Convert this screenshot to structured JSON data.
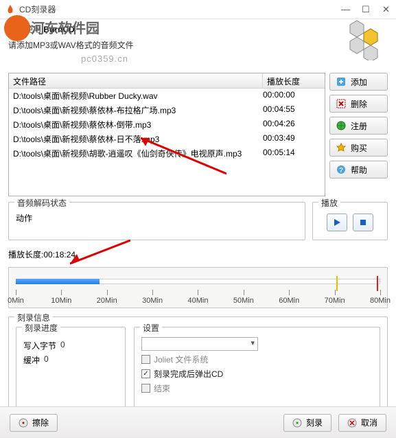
{
  "window": {
    "title": "CD刻录器",
    "minimize": "—",
    "maximize": "☐",
    "close": "✕"
  },
  "watermark": {
    "text": "河东软件园",
    "url": "pc0359.cn"
  },
  "header": {
    "line1_prefix": "欢迎使用 ",
    "line1_bold": "BurnCD",
    "line2": "请添加MP3或WAV格式的音频文件"
  },
  "filelist": {
    "col_path": "文件路径",
    "col_duration": "播放长度",
    "rows": [
      {
        "path": "D:\\tools\\桌面\\新视频\\Rubber Ducky.wav",
        "dur": "00:00:00"
      },
      {
        "path": "D:\\tools\\桌面\\新视频\\蔡依林-布拉格广场.mp3",
        "dur": "00:04:55"
      },
      {
        "path": "D:\\tools\\桌面\\新视频\\蔡依林-倒带.mp3",
        "dur": "00:04:26"
      },
      {
        "path": "D:\\tools\\桌面\\新视频\\蔡依林-日不落.mp3",
        "dur": "00:03:49"
      },
      {
        "path": "D:\\tools\\桌面\\新视频\\胡歌-逍遥叹《仙剑奇侠传》电视原声.mp3",
        "dur": "00:05:14"
      }
    ]
  },
  "sidebar": {
    "add": "添加",
    "delete": "删除",
    "register": "注册",
    "buy": "购买",
    "help": "帮助"
  },
  "decode": {
    "legend": "音频解码状态",
    "action_label": "动作"
  },
  "play": {
    "legend": "播放"
  },
  "timeline": {
    "label_prefix": "播放长度:",
    "value": "00:18:24",
    "ticks": [
      "0Min",
      "10Min",
      "20Min",
      "30Min",
      "40Min",
      "50Min",
      "60Min",
      "70Min",
      "80Min"
    ],
    "fill_percent": 23,
    "yellow_marker_percent": 88,
    "red_marker_percent": 99
  },
  "burn": {
    "legend": "刻录信息",
    "progress_legend": "刻录进度",
    "bytes_label": "写入字节",
    "bytes_value": "0",
    "buffer_label": "缓冲",
    "buffer_value": "0",
    "settings_legend": "设置",
    "cb_joliet": "Joliet 文件系统",
    "cb_eject": "刻录完成后弹出CD",
    "cb_finalize": "结束"
  },
  "footer": {
    "erase": "擦除",
    "burn": "刻录",
    "cancel": "取消"
  }
}
